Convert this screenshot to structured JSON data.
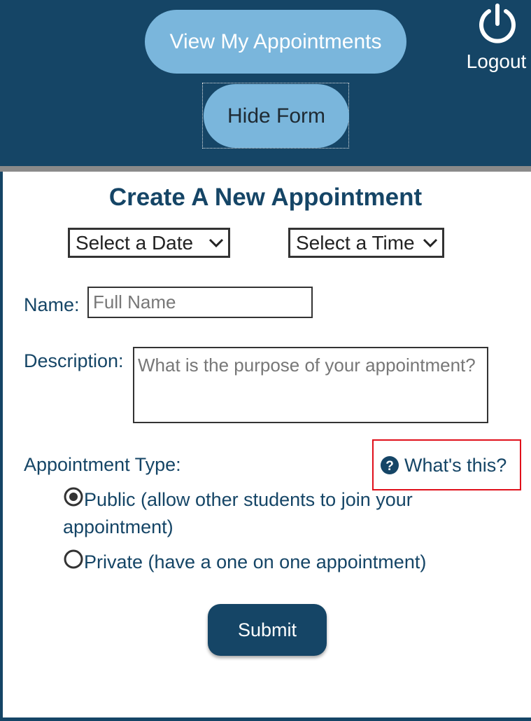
{
  "header": {
    "view_appointments_label": "View My Appointments",
    "hide_form_label": "Hide Form",
    "logout_label": "Logout",
    "logout_icon": "power-icon"
  },
  "form": {
    "title": "Create A New Appointment",
    "date_select": {
      "selected": "Select a Date"
    },
    "time_select": {
      "selected": "Select a Time"
    },
    "name_label": "Name:",
    "name_placeholder": "Full Name",
    "description_label": "Description:",
    "description_placeholder": "What is the purpose of your appointment?",
    "type_label": "Appointment Type:",
    "whats_this_label": "What's this?",
    "options": [
      {
        "label": "Public (allow other students to join your appointment)",
        "selected": true
      },
      {
        "label": "Private (have a one on one appointment)",
        "selected": false
      }
    ],
    "submit_label": "Submit"
  },
  "colors": {
    "primary": "#154566",
    "accent_light": "#7ab6dc",
    "highlight_border": "#e0101b"
  }
}
